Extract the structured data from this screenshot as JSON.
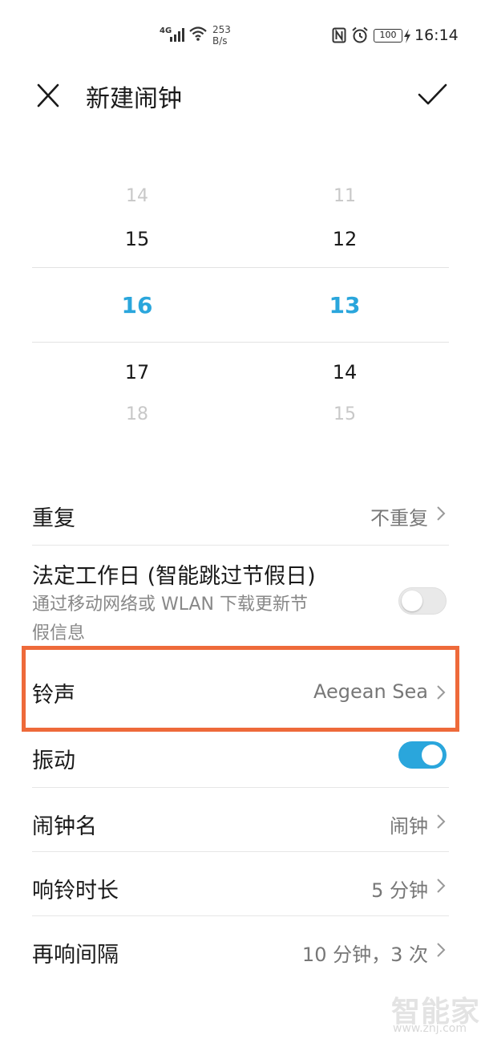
{
  "status_bar": {
    "network_type": "4G",
    "net_speed_value": "253",
    "net_speed_unit": "B/s",
    "battery_level": "100",
    "time": "16:14"
  },
  "header": {
    "title": "新建闹钟"
  },
  "picker": {
    "hours": [
      "14",
      "15",
      "16",
      "17",
      "18"
    ],
    "minutes": [
      "11",
      "12",
      "13",
      "14",
      "15"
    ],
    "selected_hour": "16",
    "selected_minute": "13"
  },
  "settings": {
    "repeat": {
      "label": "重复",
      "value": "不重复"
    },
    "workday": {
      "label": "法定工作日 (智能跳过节假日)",
      "description_line1": "通过移动网络或 WLAN 下载更新节",
      "description_line2": "假信息",
      "enabled": false
    },
    "ringtone": {
      "label": "铃声",
      "value": "Aegean Sea"
    },
    "vibration": {
      "label": "振动",
      "enabled": true
    },
    "alarm_name": {
      "label": "闹钟名",
      "value": "闹钟"
    },
    "ring_duration": {
      "label": "响铃时长",
      "value": "5 分钟"
    },
    "snooze_interval": {
      "label": "再响间隔",
      "value": "10 分钟，3 次"
    }
  },
  "colors": {
    "accent": "#2aa6dc",
    "highlight_border": "#ee6a3a"
  },
  "watermark": {
    "brand": "智能家",
    "url": "www.znj.com"
  }
}
